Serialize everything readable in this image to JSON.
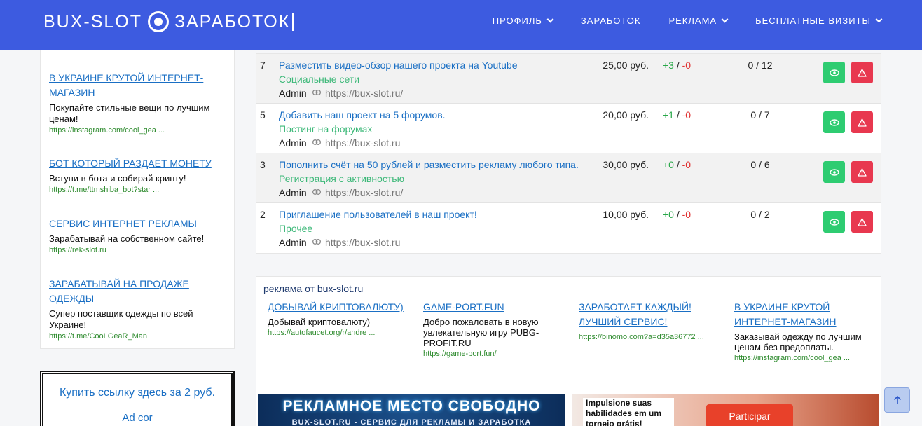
{
  "header": {
    "logo_left": "BUX-SLOT",
    "logo_right": "ЗАРАБОТОК",
    "nav": [
      {
        "label": "ПРОФИЛЬ",
        "dropdown": true
      },
      {
        "label": "ЗАРАБОТОК",
        "dropdown": false
      },
      {
        "label": "РЕКЛАМА",
        "dropdown": true
      },
      {
        "label": "БЕСПЛАТНЫЕ ВИЗИТЫ",
        "dropdown": true
      }
    ]
  },
  "sidebar": {
    "ads": [
      {
        "title": "В УКРАИНЕ КРУТОЙ ИНТЕРНЕТ-МАГАЗИН",
        "desc": "Покупайте стильные вещи по лучшим ценам!",
        "url": "https://instagram.com/cool_gea ..."
      },
      {
        "title": "БОТ КОТОРЫЙ РАЗДАЕТ МОНЕТУ",
        "desc": "Вступи в бота и собирай крипту!",
        "url": "https://t.me/ttmshiba_bot?star ..."
      },
      {
        "title": "СЕРВИС ИНТЕРНЕТ РЕКЛАМЫ",
        "desc": "Зарабатывай на собственном сайте!",
        "url": "https://rek-slot.ru"
      },
      {
        "title": "ЗАРАБАТЫВАЙ НА ПРОДАЖЕ ОДЕЖДЫ",
        "desc": "Супер поставщик одежды по всей Украине!",
        "url": "https://t.me/CooLGeaR_Man"
      }
    ],
    "buy_link": "Купить ссылку здесь за 2 руб.",
    "ad_cor": "Ad cor"
  },
  "tasks": [
    {
      "num": "7",
      "title": "Разместить видео-обзор нашего проекта на Youtube",
      "category": "Социальные сети",
      "author": "Admin",
      "site": "https://bux-slot.ru/",
      "price": "25,00 руб.",
      "plus": "+3",
      "minus": "-0",
      "progress": "0 / 12"
    },
    {
      "num": "5",
      "title": "Добавить наш проект на 5 форумов.",
      "category": "Постинг на форумах",
      "author": "Admin",
      "site": "https://bux-slot.ru",
      "price": "20,00 руб.",
      "plus": "+1",
      "minus": "-0",
      "progress": "0 / 7"
    },
    {
      "num": "3",
      "title": "Пополнить счёт на 50 рублей и разместить рекламу любого типа.",
      "category": "Регистрация с активностью",
      "author": "Admin",
      "site": "https://bux-slot.ru/",
      "price": "30,00 руб.",
      "plus": "+0",
      "minus": "-0",
      "progress": "0 / 6"
    },
    {
      "num": "2",
      "title": "Приглашение пользователей в наш проект!",
      "category": "Прочее",
      "author": "Admin",
      "site": "https://bux-slot.ru",
      "price": "10,00 руб.",
      "plus": "+0",
      "minus": "-0",
      "progress": "0 / 2"
    }
  ],
  "ads_block": {
    "heading": "реклама от bux-slot.ru",
    "items": [
      {
        "title": "ДОБЫВАЙ КРИПТОВАЛЮТУ)",
        "desc": "Добывай криптовалюту)",
        "url": "https://autofaucet.org/r/andre ..."
      },
      {
        "title": "GAME-PORT.FUN",
        "desc": "Добро пожаловать в новую увлекательную игру PUBG-PROFIT.RU",
        "url": "https://game-port.fun/"
      },
      {
        "title": "ЗАРАБОТАЕТ КАЖДЫЙ! ЛУЧШИЙ СЕРВИС!",
        "desc": "",
        "url": "https://binomo.com?a=d35a36772 ..."
      },
      {
        "title": "В УКРАИНЕ КРУТОЙ ИНТЕРНЕТ-МАГАЗИН",
        "desc": "Заказывай одежду по лучшим ценам без предоплаты.",
        "url": "https://instagram.com/cool_gea ..."
      }
    ],
    "banner_left_title": "РЕКЛАМНОЕ МЕСТО СВОБОДНО",
    "banner_left_sub": "BUX-SLOT.RU - СЕРВИС ДЛЯ РЕКЛАМЫ И ЗАРАБОТКА",
    "banner_right_text": "Impulsione suas habilidades em um torneio grátis!",
    "banner_right_button": "Participar"
  },
  "colors": {
    "header": "#3d5be0",
    "link": "#1a6fc4",
    "category": "#3cb878",
    "view_button": "#2ecc71",
    "warn_button": "#e8384f"
  },
  "icons": [
    "eye-icon",
    "warning-icon",
    "link-icon",
    "arrow-up-icon",
    "chevron-down-icon"
  ]
}
